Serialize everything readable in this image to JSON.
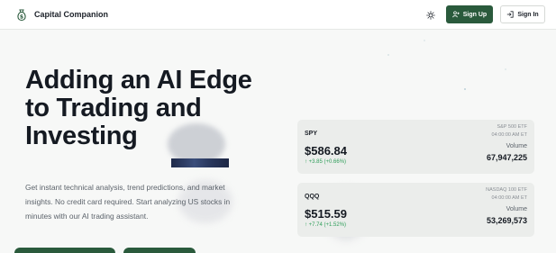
{
  "header": {
    "logo_icon": "money-bag-icon",
    "brand": "Capital Companion",
    "theme_icon": "sun-icon",
    "signup_icon": "user-plus-icon",
    "signup_label": "Sign Up",
    "signin_icon": "login-icon",
    "signin_label": "Sign In"
  },
  "hero": {
    "headline": "Adding an AI Edge to Trading and Investing",
    "subtext": "Get instant technical analysis, trend predictions, and market insights. No credit card required. Start analyzing US stocks in minutes with our AI trading assistant."
  },
  "quotes": [
    {
      "symbol": "SPY",
      "name": "S&P 500 ETF",
      "as_of": "04:00:00 AM ET",
      "price": "$586.84",
      "change": "↑ +3.85 (+0.66%)",
      "volume_label": "Volume",
      "volume": "67,947,225"
    },
    {
      "symbol": "QQQ",
      "name": "NASDAQ 100 ETF",
      "as_of": "04:00:00 AM ET",
      "price": "$515.59",
      "change": "↑ +7.74 (+1.52%)",
      "volume_label": "Volume",
      "volume": "53,269,573"
    }
  ],
  "colors": {
    "accent": "#2a5a3c",
    "positive": "#2f9e5a",
    "card_bg": "#ebedeb",
    "page_bg": "#f7f8f7"
  }
}
